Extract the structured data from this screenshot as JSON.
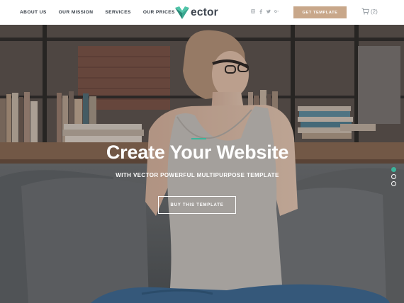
{
  "nav": {
    "items": [
      "ABOUT US",
      "OUR MISSION",
      "SERVICES",
      "OUR PRICES"
    ]
  },
  "logo": {
    "text": "ector",
    "icon": "v-logo-icon",
    "colors": {
      "mark_light": "#4fc4a8",
      "mark_dark": "#2a8a78"
    }
  },
  "socials": [
    "instagram-icon",
    "facebook-icon",
    "twitter-icon",
    "google-plus-icon"
  ],
  "cta": {
    "label": "GET TEMPLATE",
    "color": "#c8a78a"
  },
  "cart": {
    "icon": "cart-icon",
    "count": "(2)"
  },
  "hero": {
    "title": "Create Your Website",
    "subtitle": "WITH VECTOR POWERFUL MULTIPURPOSE TEMPLATE",
    "button_label": "BUY THIS TEMPLATE",
    "slides_total": 3,
    "active_slide": 1,
    "accent_color": "#3cb49a"
  }
}
